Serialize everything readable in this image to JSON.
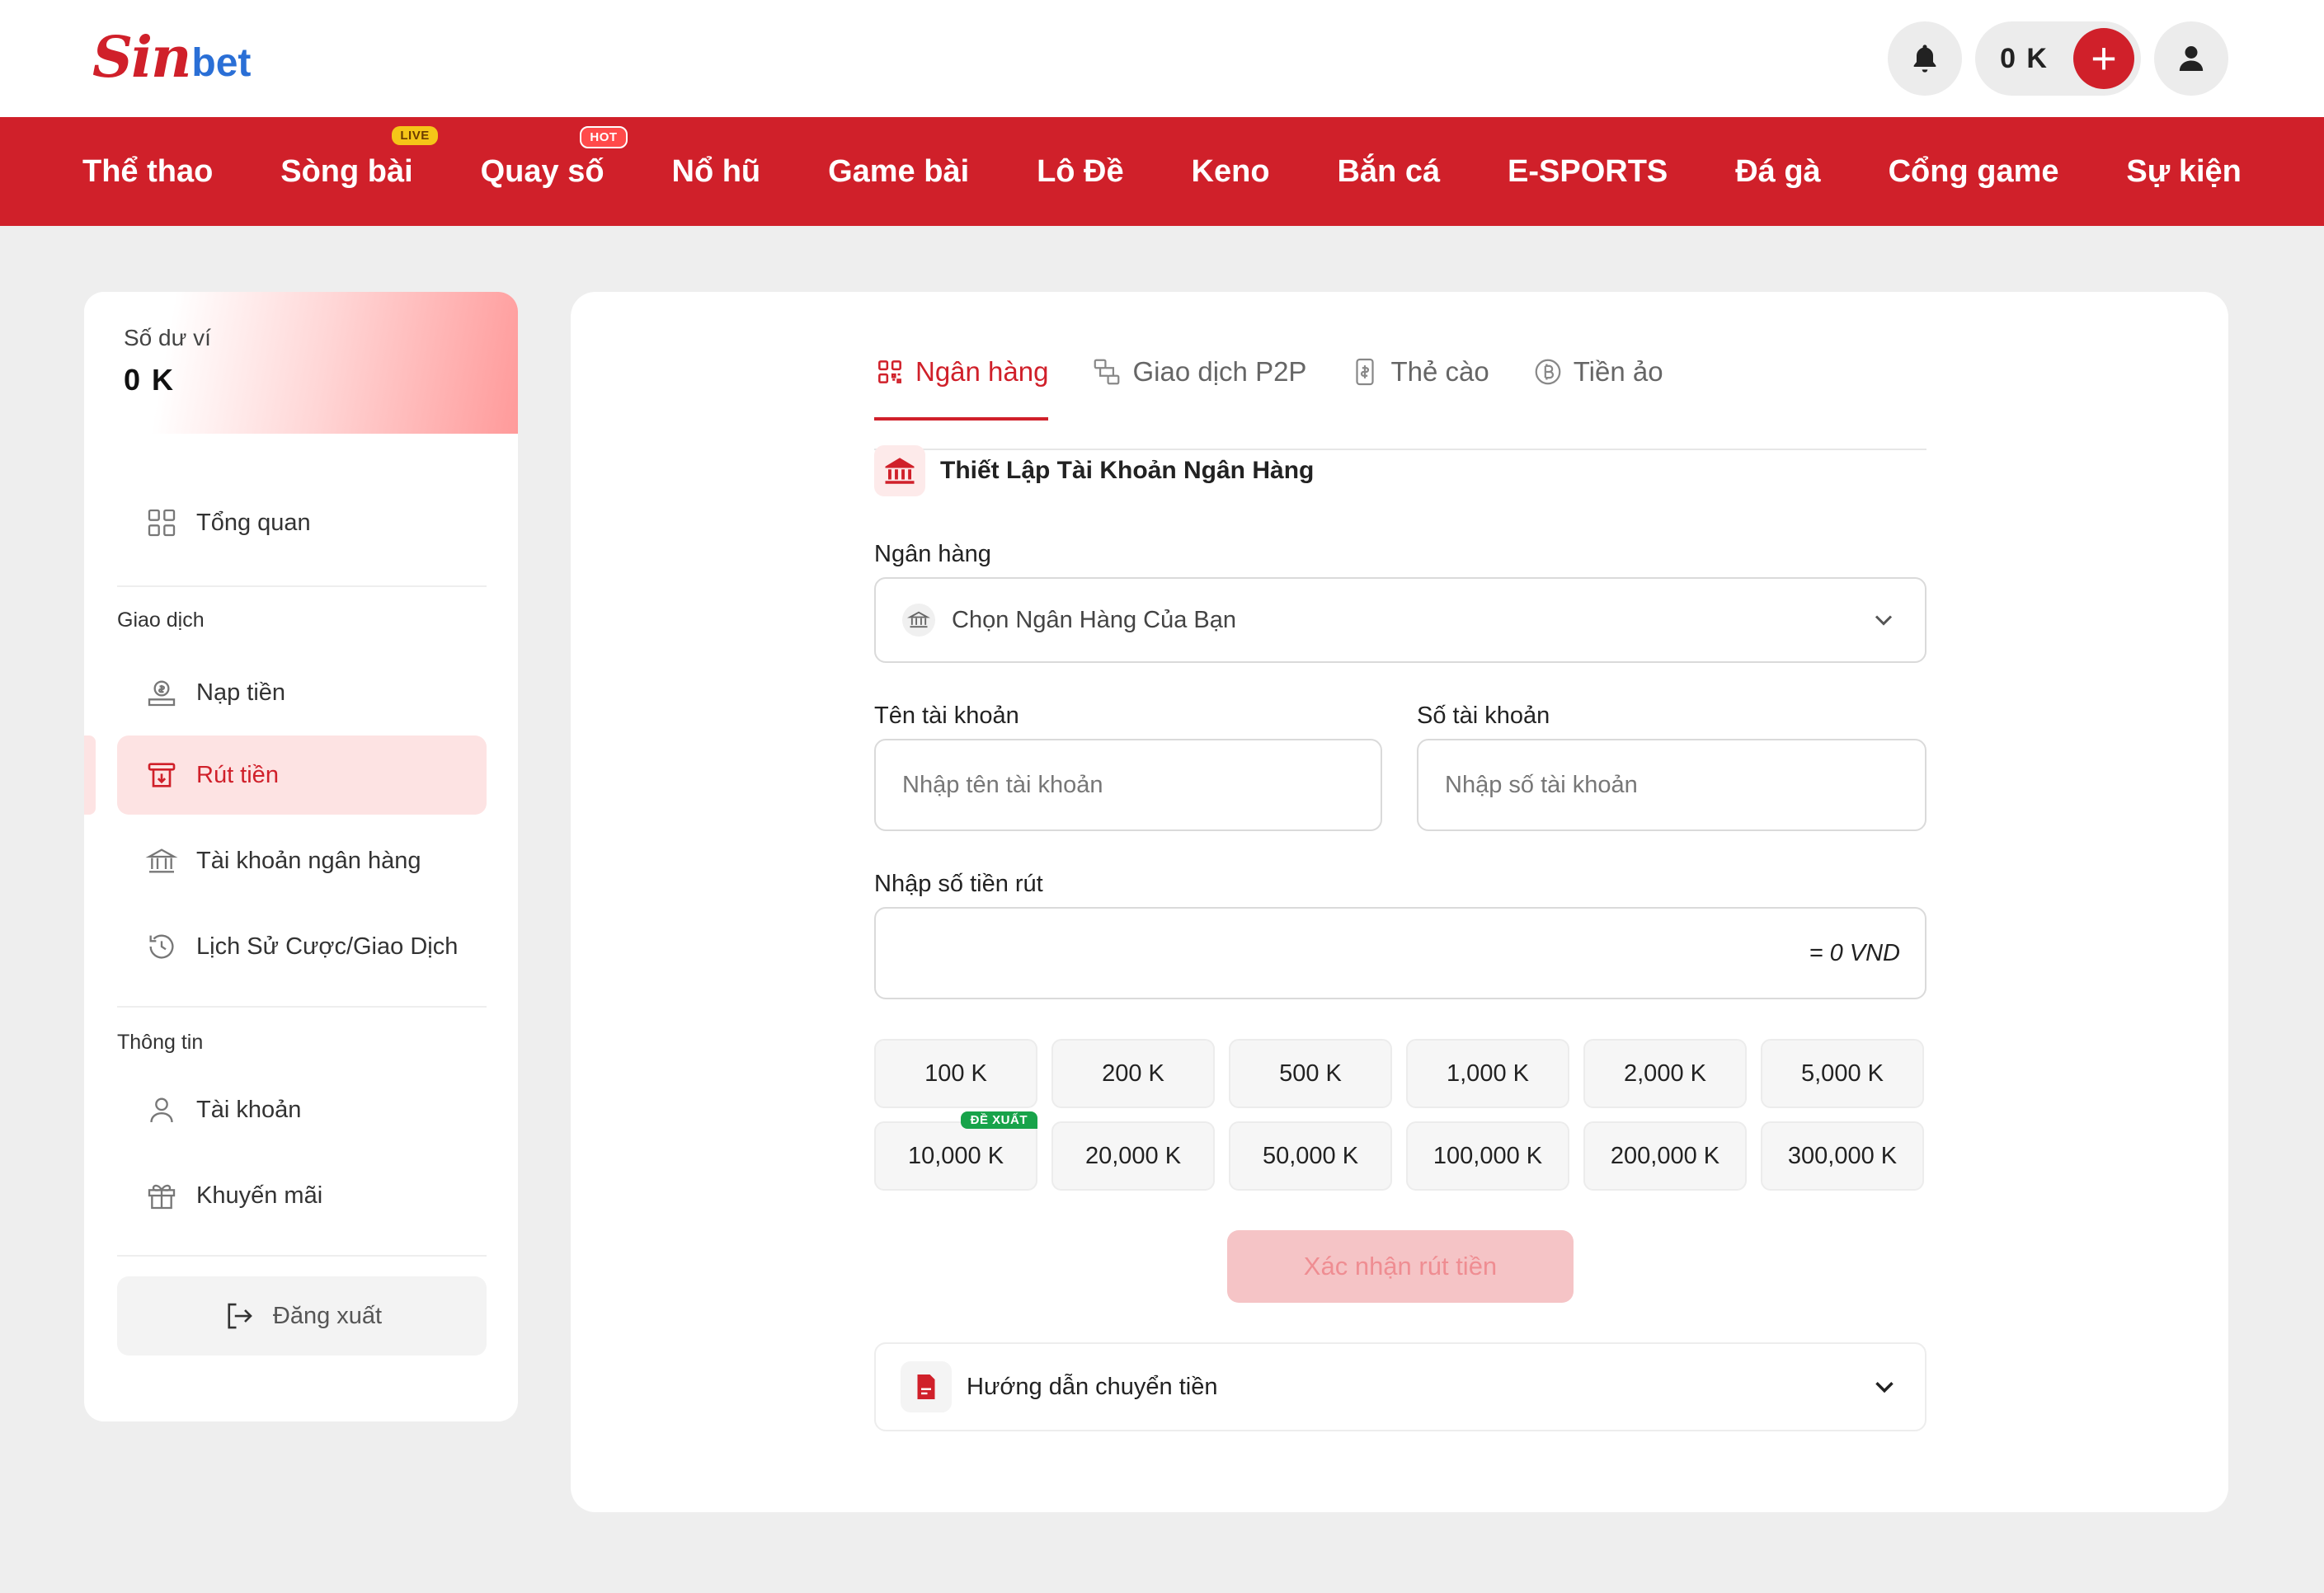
{
  "header": {
    "logo_s": "S",
    "logo_in": "in",
    "logo_bet": "bet",
    "balance": "0 K",
    "add_label": "+"
  },
  "nav": {
    "items": [
      {
        "label": "Thể thao",
        "badge": ""
      },
      {
        "label": "Sòng bài",
        "badge": "LIVE"
      },
      {
        "label": "Quay số",
        "badge": "HOT"
      },
      {
        "label": "Nổ hũ",
        "badge": ""
      },
      {
        "label": "Game bài",
        "badge": ""
      },
      {
        "label": "Lô Đề",
        "badge": ""
      },
      {
        "label": "Keno",
        "badge": ""
      },
      {
        "label": "Bắn cá",
        "badge": ""
      },
      {
        "label": "E-SPORTS",
        "badge": ""
      },
      {
        "label": "Đá gà",
        "badge": ""
      },
      {
        "label": "Cổng game",
        "badge": ""
      },
      {
        "label": "Sự kiện",
        "badge": ""
      }
    ]
  },
  "sidebar": {
    "wallet_label": "Số dư ví",
    "wallet_amount": "0 K",
    "overview": "Tổng quan",
    "section_transactions": "Giao dịch",
    "deposit": "Nạp tiền",
    "withdraw": "Rút tiền",
    "bank_accounts": "Tài khoản ngân hàng",
    "history": "Lịch Sử Cược/Giao Dịch",
    "section_info": "Thông tin",
    "account": "Tài khoản",
    "promotions": "Khuyến mãi",
    "logout": "Đăng xuất"
  },
  "main": {
    "tabs": [
      {
        "label": "Ngân hàng",
        "icon": "qr-icon",
        "active": true
      },
      {
        "label": "Giao dịch P2P",
        "icon": "p2p-icon",
        "active": false
      },
      {
        "label": "Thẻ cào",
        "icon": "card-icon",
        "active": false
      },
      {
        "label": "Tiền ảo",
        "icon": "bitcoin-icon",
        "active": false
      }
    ],
    "setup_title": "Thiết Lập Tài Khoản Ngân Hàng",
    "bank_label": "Ngân hàng",
    "bank_placeholder": "Chọn Ngân Hàng Của Bạn",
    "account_name_label": "Tên tài khoản",
    "account_name_placeholder": "Nhập tên tài khoản",
    "account_number_label": "Số tài khoản",
    "account_number_placeholder": "Nhập số tài khoản",
    "amount_label": "Nhập số tiền rút",
    "amount_suffix": "= 0 VND",
    "chips": [
      "100 K",
      "200 K",
      "500 K",
      "1,000 K",
      "2,000 K",
      "5,000 K",
      "10,000 K",
      "20,000 K",
      "50,000 K",
      "100,000 K",
      "200,000 K",
      "300,000 K"
    ],
    "recommended_badge": "ĐỀ XUẤT",
    "confirm_label": "Xác nhận rút tiền",
    "guide_label": "Hướng dẫn chuyển tiền"
  },
  "colors": {
    "brand_red": "#d0202a",
    "active_bg": "#fde3e3",
    "badge_green": "#18a34a",
    "logo_blue": "#2a6fd6"
  }
}
